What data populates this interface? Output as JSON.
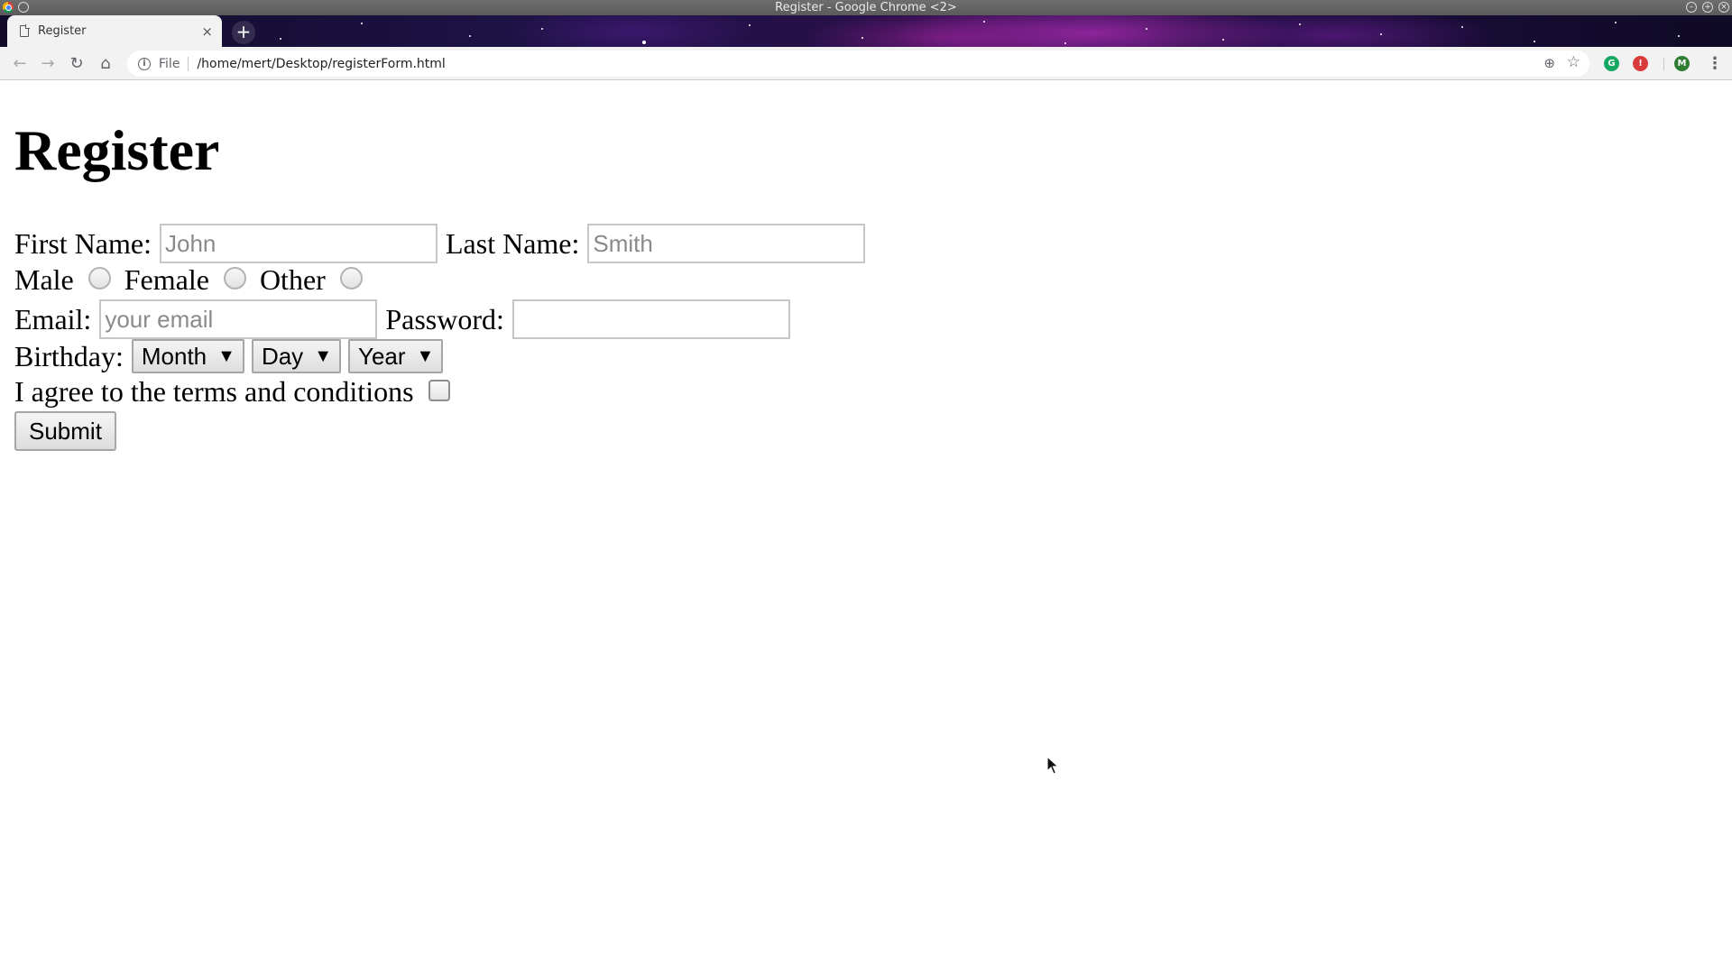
{
  "window": {
    "title": "Register - Google Chrome <2>"
  },
  "tabs": [
    {
      "label": "Register",
      "close": "×"
    }
  ],
  "new_tab_label": "+",
  "toolbar": {
    "back": "←",
    "forward": "→",
    "reload": "↻",
    "home": "⌂",
    "info_glyph": "i",
    "scheme": "File",
    "url": "/home/mert/Desktop/registerForm.html",
    "zoom": "⊕",
    "bookmark": "☆",
    "extensions": [
      "G",
      "!",
      "M"
    ],
    "menu": "⋮"
  },
  "icons": {
    "page": "page-icon",
    "info": "info-icon",
    "zoom": "zoom-icon",
    "bookmark": "star-icon",
    "profile": "avatar"
  },
  "form": {
    "heading": "Register",
    "first_name_label": "First Name:",
    "first_name_placeholder": "John",
    "last_name_label": "Last Name:",
    "last_name_placeholder": "Smith",
    "gender_options": [
      "Male",
      "Female",
      "Other"
    ],
    "email_label": "Email:",
    "email_placeholder": "your email",
    "password_label": "Password:",
    "password_placeholder": "",
    "birthday_label": "Birthday:",
    "month": "Month",
    "day": "Day",
    "year": "Year",
    "dropdown_arrow": "▼",
    "terms_label": "I agree to the terms and conditions",
    "submit_label": "Submit"
  },
  "colors": {
    "toolbar_bg": "#f2f2f2",
    "titlebar_bg": "#5f5f5f",
    "ext_green": "#15a862",
    "ext_red": "#d93b3b",
    "profile_green": "#2e7d32"
  }
}
